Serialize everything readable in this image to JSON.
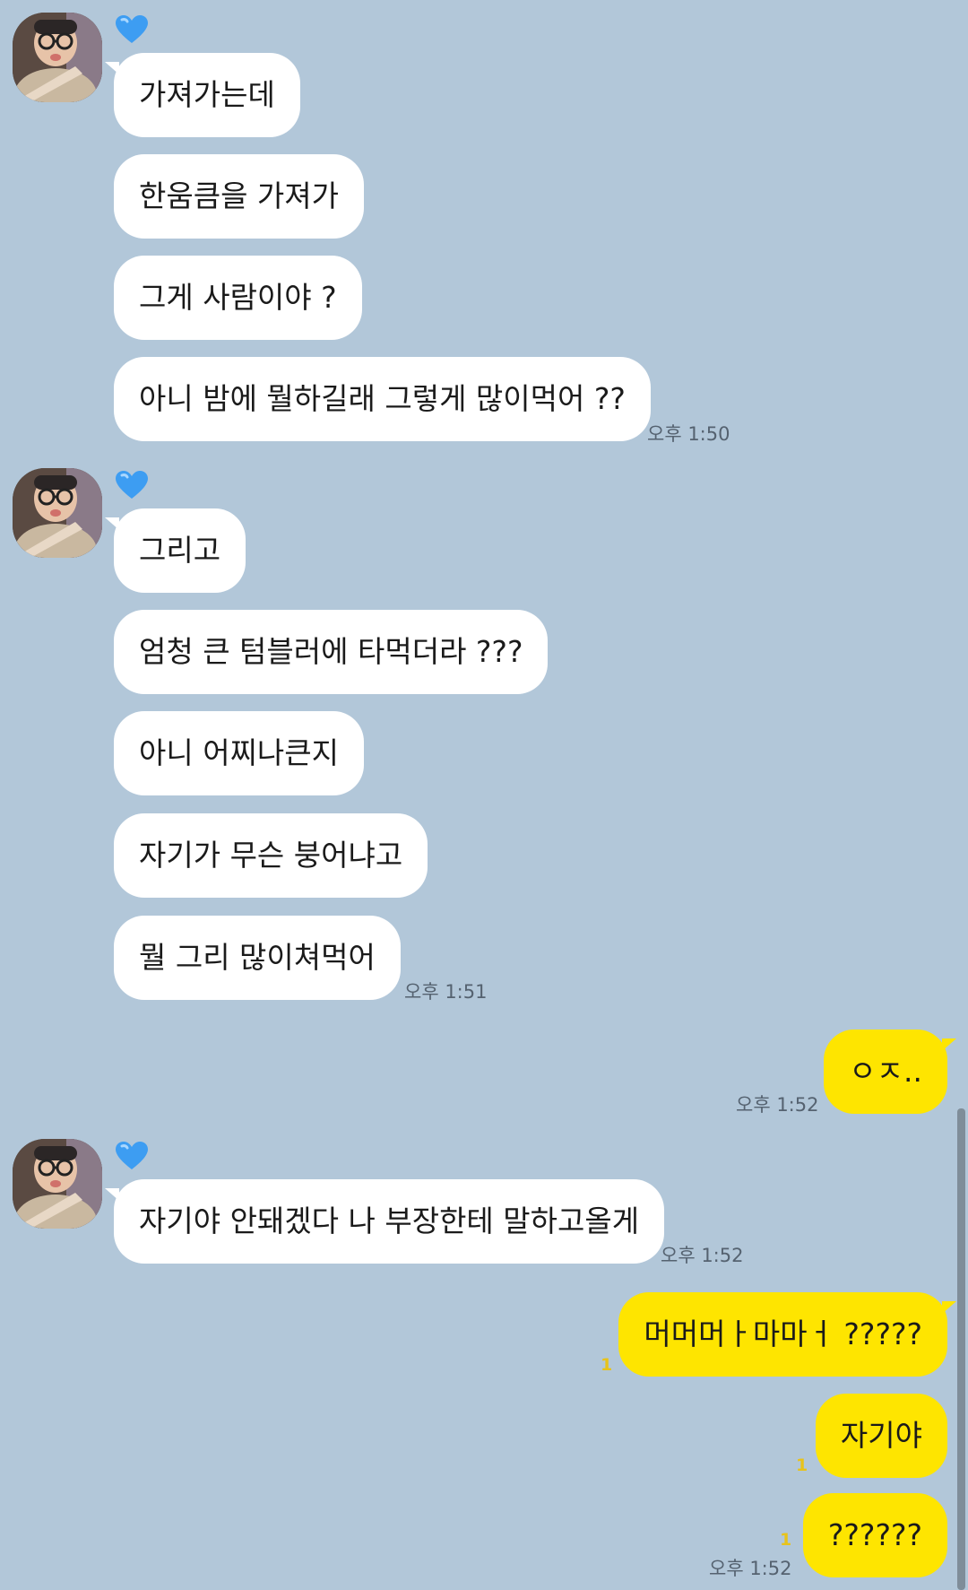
{
  "messages": {
    "g1": [
      "가져가는데",
      "한움큼을 가져가",
      "그게 사람이야 ?",
      "아니 밤에 뭘하길래 그렇게 많이먹어 ??"
    ],
    "g1_time": "오후 1:50",
    "g2": [
      "그리고",
      "엄청 큰 텀블러에 타먹더라 ???",
      "아니 어찌나큰지",
      "자기가 무슨 붕어냐고",
      "뭘 그리 많이쳐먹어"
    ],
    "g2_time": "오후 1:51",
    "s1": "ㅇㅈ..",
    "s1_time": "오후 1:52",
    "g3": [
      "자기야 안돼겠다 나 부장한테 말하고올게"
    ],
    "g3_time": "오후 1:52",
    "s2": [
      "머머머ㅏ마마ㅓ ?????",
      "자기야",
      "??????"
    ],
    "s2_unread": [
      "1",
      "1",
      "1"
    ],
    "s2_time": "오후 1:52"
  },
  "colors": {
    "background": "#b2c7d9",
    "incoming_bubble": "#ffffff",
    "outgoing_bubble": "#fee500",
    "heart": "#3d9df2",
    "unread": "#e8c31a"
  },
  "icons": {
    "profile": "avatar",
    "badge": "heart-icon"
  }
}
